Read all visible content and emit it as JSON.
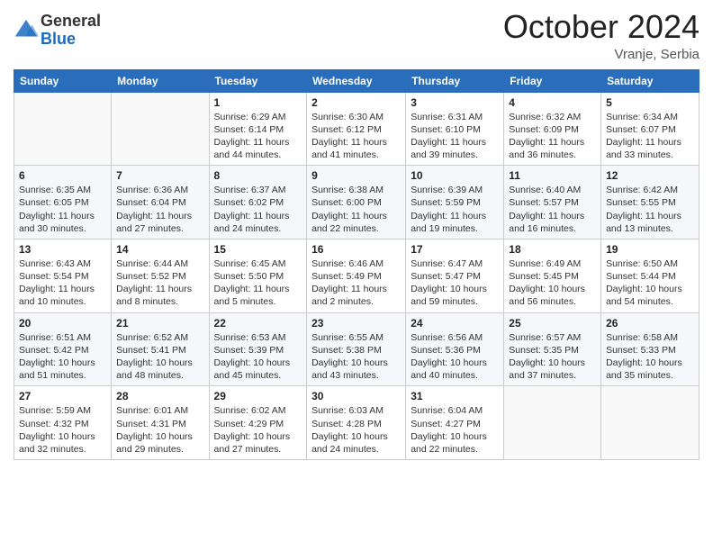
{
  "header": {
    "logo_general": "General",
    "logo_blue": "Blue",
    "month_title": "October 2024",
    "location": "Vranje, Serbia"
  },
  "days_of_week": [
    "Sunday",
    "Monday",
    "Tuesday",
    "Wednesday",
    "Thursday",
    "Friday",
    "Saturday"
  ],
  "weeks": [
    [
      {
        "num": "",
        "info": ""
      },
      {
        "num": "",
        "info": ""
      },
      {
        "num": "1",
        "info": "Sunrise: 6:29 AM\nSunset: 6:14 PM\nDaylight: 11 hours and 44 minutes."
      },
      {
        "num": "2",
        "info": "Sunrise: 6:30 AM\nSunset: 6:12 PM\nDaylight: 11 hours and 41 minutes."
      },
      {
        "num": "3",
        "info": "Sunrise: 6:31 AM\nSunset: 6:10 PM\nDaylight: 11 hours and 39 minutes."
      },
      {
        "num": "4",
        "info": "Sunrise: 6:32 AM\nSunset: 6:09 PM\nDaylight: 11 hours and 36 minutes."
      },
      {
        "num": "5",
        "info": "Sunrise: 6:34 AM\nSunset: 6:07 PM\nDaylight: 11 hours and 33 minutes."
      }
    ],
    [
      {
        "num": "6",
        "info": "Sunrise: 6:35 AM\nSunset: 6:05 PM\nDaylight: 11 hours and 30 minutes."
      },
      {
        "num": "7",
        "info": "Sunrise: 6:36 AM\nSunset: 6:04 PM\nDaylight: 11 hours and 27 minutes."
      },
      {
        "num": "8",
        "info": "Sunrise: 6:37 AM\nSunset: 6:02 PM\nDaylight: 11 hours and 24 minutes."
      },
      {
        "num": "9",
        "info": "Sunrise: 6:38 AM\nSunset: 6:00 PM\nDaylight: 11 hours and 22 minutes."
      },
      {
        "num": "10",
        "info": "Sunrise: 6:39 AM\nSunset: 5:59 PM\nDaylight: 11 hours and 19 minutes."
      },
      {
        "num": "11",
        "info": "Sunrise: 6:40 AM\nSunset: 5:57 PM\nDaylight: 11 hours and 16 minutes."
      },
      {
        "num": "12",
        "info": "Sunrise: 6:42 AM\nSunset: 5:55 PM\nDaylight: 11 hours and 13 minutes."
      }
    ],
    [
      {
        "num": "13",
        "info": "Sunrise: 6:43 AM\nSunset: 5:54 PM\nDaylight: 11 hours and 10 minutes."
      },
      {
        "num": "14",
        "info": "Sunrise: 6:44 AM\nSunset: 5:52 PM\nDaylight: 11 hours and 8 minutes."
      },
      {
        "num": "15",
        "info": "Sunrise: 6:45 AM\nSunset: 5:50 PM\nDaylight: 11 hours and 5 minutes."
      },
      {
        "num": "16",
        "info": "Sunrise: 6:46 AM\nSunset: 5:49 PM\nDaylight: 11 hours and 2 minutes."
      },
      {
        "num": "17",
        "info": "Sunrise: 6:47 AM\nSunset: 5:47 PM\nDaylight: 10 hours and 59 minutes."
      },
      {
        "num": "18",
        "info": "Sunrise: 6:49 AM\nSunset: 5:45 PM\nDaylight: 10 hours and 56 minutes."
      },
      {
        "num": "19",
        "info": "Sunrise: 6:50 AM\nSunset: 5:44 PM\nDaylight: 10 hours and 54 minutes."
      }
    ],
    [
      {
        "num": "20",
        "info": "Sunrise: 6:51 AM\nSunset: 5:42 PM\nDaylight: 10 hours and 51 minutes."
      },
      {
        "num": "21",
        "info": "Sunrise: 6:52 AM\nSunset: 5:41 PM\nDaylight: 10 hours and 48 minutes."
      },
      {
        "num": "22",
        "info": "Sunrise: 6:53 AM\nSunset: 5:39 PM\nDaylight: 10 hours and 45 minutes."
      },
      {
        "num": "23",
        "info": "Sunrise: 6:55 AM\nSunset: 5:38 PM\nDaylight: 10 hours and 43 minutes."
      },
      {
        "num": "24",
        "info": "Sunrise: 6:56 AM\nSunset: 5:36 PM\nDaylight: 10 hours and 40 minutes."
      },
      {
        "num": "25",
        "info": "Sunrise: 6:57 AM\nSunset: 5:35 PM\nDaylight: 10 hours and 37 minutes."
      },
      {
        "num": "26",
        "info": "Sunrise: 6:58 AM\nSunset: 5:33 PM\nDaylight: 10 hours and 35 minutes."
      }
    ],
    [
      {
        "num": "27",
        "info": "Sunrise: 5:59 AM\nSunset: 4:32 PM\nDaylight: 10 hours and 32 minutes."
      },
      {
        "num": "28",
        "info": "Sunrise: 6:01 AM\nSunset: 4:31 PM\nDaylight: 10 hours and 29 minutes."
      },
      {
        "num": "29",
        "info": "Sunrise: 6:02 AM\nSunset: 4:29 PM\nDaylight: 10 hours and 27 minutes."
      },
      {
        "num": "30",
        "info": "Sunrise: 6:03 AM\nSunset: 4:28 PM\nDaylight: 10 hours and 24 minutes."
      },
      {
        "num": "31",
        "info": "Sunrise: 6:04 AM\nSunset: 4:27 PM\nDaylight: 10 hours and 22 minutes."
      },
      {
        "num": "",
        "info": ""
      },
      {
        "num": "",
        "info": ""
      }
    ]
  ]
}
